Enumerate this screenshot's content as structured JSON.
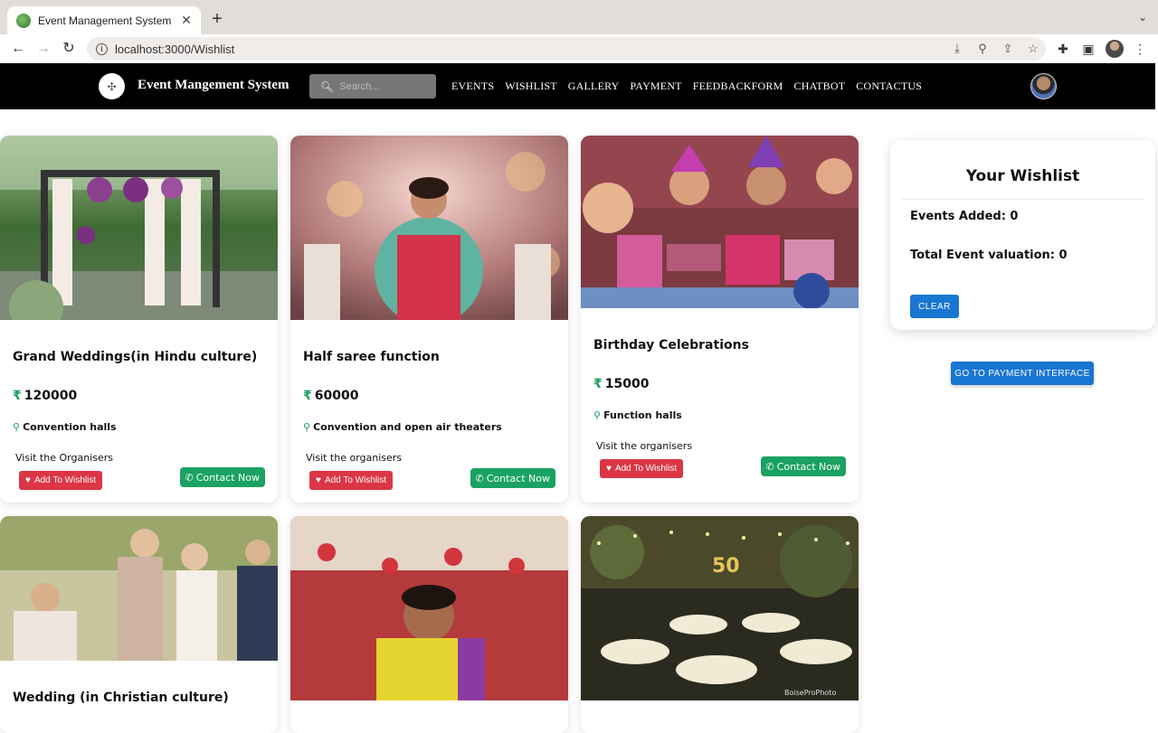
{
  "browser": {
    "tab_title": "Event Management System",
    "url": "localhost:3000/Wishlist"
  },
  "navbar": {
    "brand": "Event Mangement System",
    "search_placeholder": "Search...",
    "links": [
      "EVENTS",
      "WISHLIST",
      "GALLERY",
      "PAYMENT",
      "FEEDBACKFORM",
      "CHATBOT",
      "CONTACTUS"
    ]
  },
  "cards": [
    {
      "title": "Grand Weddings(in Hindu culture)",
      "price": "120000",
      "venue": "Convention halls",
      "visit": "Visit the Organisers",
      "wish_label": "Add To Wishlist",
      "contact_label": "Contact Now"
    },
    {
      "title": "Half saree function",
      "price": "60000",
      "venue": "Convention and open air theaters",
      "visit": "Visit the organisers",
      "wish_label": "Add To Wishlist",
      "contact_label": "Contact Now"
    },
    {
      "title": "Birthday Celebrations",
      "price": "15000",
      "venue": "Function halls",
      "visit": "Visit the organisers",
      "wish_label": "Add To Wishlist",
      "contact_label": "Contact Now"
    },
    {
      "title": "Wedding (in Christian culture)"
    },
    {
      "title": ""
    },
    {
      "title": "",
      "photo_caption": "BoiseProPhoto",
      "photo_number": "50"
    }
  ],
  "wishlist": {
    "title": "Your Wishlist",
    "events_added_label": "Events Added: 0",
    "valuation_label": "Total Event valuation: 0",
    "clear_label": "CLEAR",
    "payment_label": "GO TO PAYMENT INTERFACE"
  },
  "colors": {
    "accent_blue": "#1976d2",
    "wish_red": "#dc3545",
    "contact_green": "#1aa262",
    "nav_black": "#000000"
  }
}
